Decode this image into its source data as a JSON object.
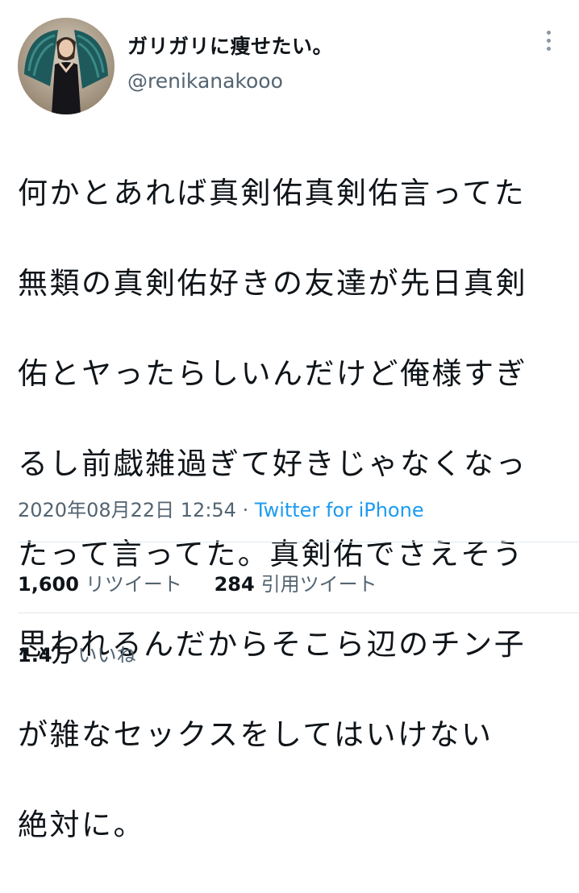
{
  "tweet": {
    "display_name": "ガリガリに痩せたい。",
    "handle": "@renikanakooo",
    "lines": [
      "何かとあれば真剣佑真剣佑言ってた",
      "無類の真剣佑好きの友達が先日真剣",
      "佑とヤったらしいんだけど俺様すぎ",
      "るし前戯雑過ぎて好きじゃなくなっ",
      "たって言ってた。真剣佑でさえそう",
      "思われるんだからそこら辺のチン子",
      "が雑なセックスをしてはいけない",
      "絶対に。"
    ],
    "datetime": "2020年08月22日 12:54",
    "separator": "·",
    "source": "Twitter for iPhone"
  },
  "stats": {
    "retweets": {
      "count": "1,600",
      "label": "リツイート"
    },
    "quotes": {
      "count": "284",
      "label": "引用ツイート"
    },
    "likes": {
      "count": "1.4万",
      "label": "いいね"
    }
  },
  "icons": {
    "more": "more-vertical-icon",
    "avatar": "profile-avatar"
  },
  "colors": {
    "text": "#0f1419",
    "secondary": "#536471",
    "accent": "#1d9bf0",
    "divider": "#e1e8ed"
  }
}
